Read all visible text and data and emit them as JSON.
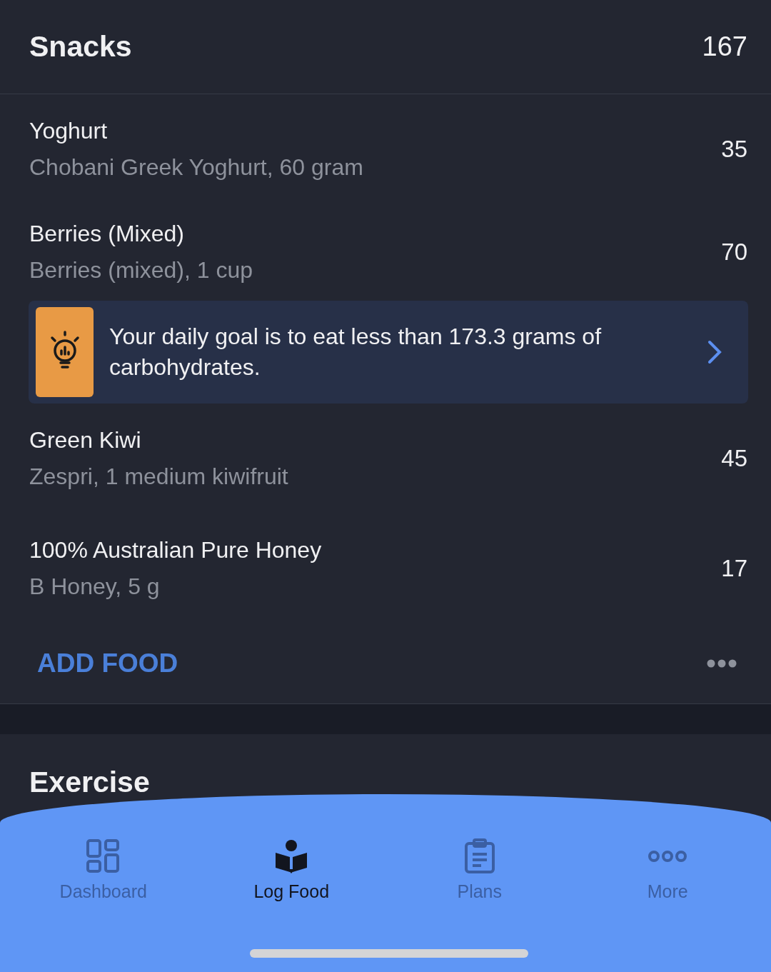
{
  "section": {
    "title": "Snacks",
    "total": "167"
  },
  "entries": [
    {
      "kind": "food",
      "name": "Yoghurt",
      "detail": "Chobani Greek Yoghurt, 60 gram",
      "calories": "35"
    },
    {
      "kind": "food",
      "name": "Berries (Mixed)",
      "detail": "Berries (mixed), 1 cup",
      "calories": "70"
    },
    {
      "kind": "tip",
      "text": "Your daily goal is to eat less than 173.3 grams of carbohydrates."
    },
    {
      "kind": "food",
      "name": "Green Kiwi",
      "detail": "Zespri, 1 medium kiwifruit",
      "calories": "45"
    },
    {
      "kind": "food",
      "name": "100% Australian Pure Honey",
      "detail": "B Honey, 5 g",
      "calories": "17"
    }
  ],
  "add_button": "ADD FOOD",
  "next_section": {
    "title": "Exercise"
  },
  "nav": [
    {
      "label": "Dashboard",
      "selected": false
    },
    {
      "label": "Log Food",
      "selected": true
    },
    {
      "label": "Plans",
      "selected": false
    },
    {
      "label": "More",
      "selected": false
    }
  ]
}
